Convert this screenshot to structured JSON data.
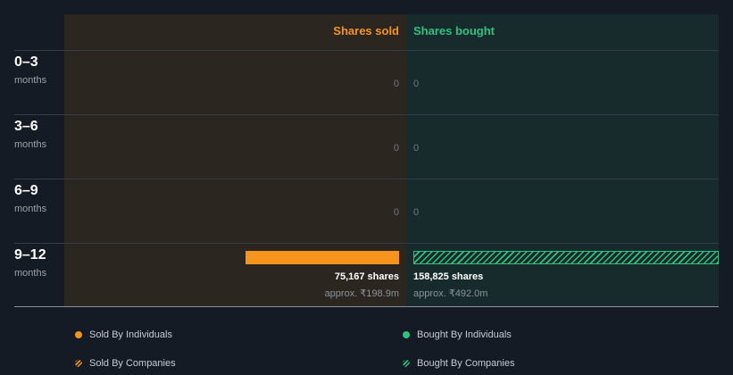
{
  "colors": {
    "sold": "#f7941d",
    "bought": "#2ec27e"
  },
  "header": {
    "sold": "Shares sold",
    "bought": "Shares bought"
  },
  "chart_data": {
    "type": "bar",
    "categories": [
      {
        "range": "0–3",
        "unit": "months"
      },
      {
        "range": "3–6",
        "unit": "months"
      },
      {
        "range": "6–9",
        "unit": "months"
      },
      {
        "range": "9–12",
        "unit": "months"
      }
    ],
    "series": [
      {
        "name": "Shares sold",
        "values": [
          0,
          0,
          0,
          75167
        ]
      },
      {
        "name": "Shares bought",
        "values": [
          0,
          0,
          0,
          158825
        ]
      }
    ],
    "labels": {
      "sold": [
        "0",
        "0",
        "0",
        "75,167 shares"
      ],
      "bought": [
        "0",
        "0",
        "0",
        "158,825 shares"
      ]
    },
    "approx": {
      "sold": [
        "",
        "",
        "",
        "approx. ₹198.9m"
      ],
      "bought": [
        "",
        "",
        "",
        "approx. ₹492.0m"
      ]
    },
    "max": 158825
  },
  "legend": [
    {
      "label": "Sold By Individuals",
      "icon": "dot",
      "color": "#f7941d"
    },
    {
      "label": "Bought By Individuals",
      "icon": "dot",
      "color": "#2ec27e"
    },
    {
      "label": "Sold By Companies",
      "icon": "hatch",
      "color": "#f7941d"
    },
    {
      "label": "Bought By Companies",
      "icon": "hatch",
      "color": "#2ec27e"
    }
  ]
}
